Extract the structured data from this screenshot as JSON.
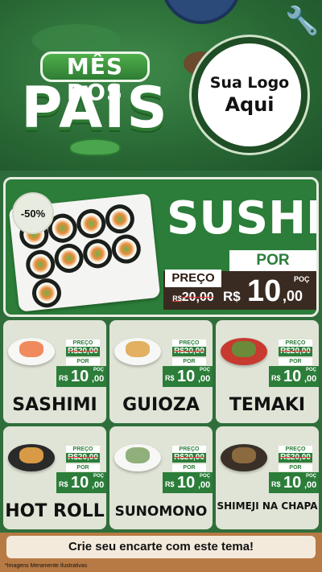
{
  "header": {
    "title_top": "MÊS DOS",
    "title_main": "PAIS",
    "logo_line1": "Sua Logo",
    "logo_line2": "Aqui"
  },
  "hero": {
    "discount": "-50%",
    "title": "SUSHI",
    "por": "POR",
    "preco_label": "PREÇO",
    "old_currency": "R$",
    "old_price": "20,00",
    "new_currency": "R$",
    "new_int": "10",
    "new_dec": ",00",
    "poc": "POÇ"
  },
  "products": [
    {
      "name": "SASHIMI",
      "preco": "PREÇO",
      "old": "R$20,00",
      "por": "POR",
      "cur": "R$",
      "int": "10",
      "dec": ",00",
      "poc": "POÇ"
    },
    {
      "name": "GUIOZA",
      "preco": "PREÇO",
      "old": "R$20,00",
      "por": "POR",
      "cur": "R$",
      "int": "10",
      "dec": ",00",
      "poc": "POÇ"
    },
    {
      "name": "TEMAKI",
      "preco": "PREÇO",
      "old": "R$20,00",
      "por": "POR",
      "cur": "R$",
      "int": "10",
      "dec": ",00",
      "poc": "POÇ"
    },
    {
      "name": "HOT ROLL",
      "preco": "PREÇO",
      "old": "R$20,00",
      "por": "POR",
      "cur": "R$",
      "int": "10",
      "dec": ",00",
      "poc": "POÇ"
    },
    {
      "name": "SUNOMONO",
      "preco": "PREÇO",
      "old": "R$20,00",
      "por": "POR",
      "cur": "R$",
      "int": "10",
      "dec": ",00",
      "poc": "POÇ"
    },
    {
      "name": "SHIMEJI NA CHAPA",
      "preco": "PREÇO",
      "old": "R$20,00",
      "por": "POR",
      "cur": "R$",
      "int": "10",
      "dec": ",00",
      "poc": "POÇ"
    }
  ],
  "footer": {
    "cta": "Crie seu encarte com este tema!",
    "disclaimer": "*Imagens Meramente Ilustrativas"
  },
  "colors": {
    "brand_green": "#2b7d39",
    "dark_green": "#1f4e26",
    "card_bg": "#dfe4d6",
    "wood": "#b77a45"
  },
  "icons": {
    "wrench": "wrench-icon",
    "tie": "tie-icon",
    "mustache": "mustache-icon"
  }
}
